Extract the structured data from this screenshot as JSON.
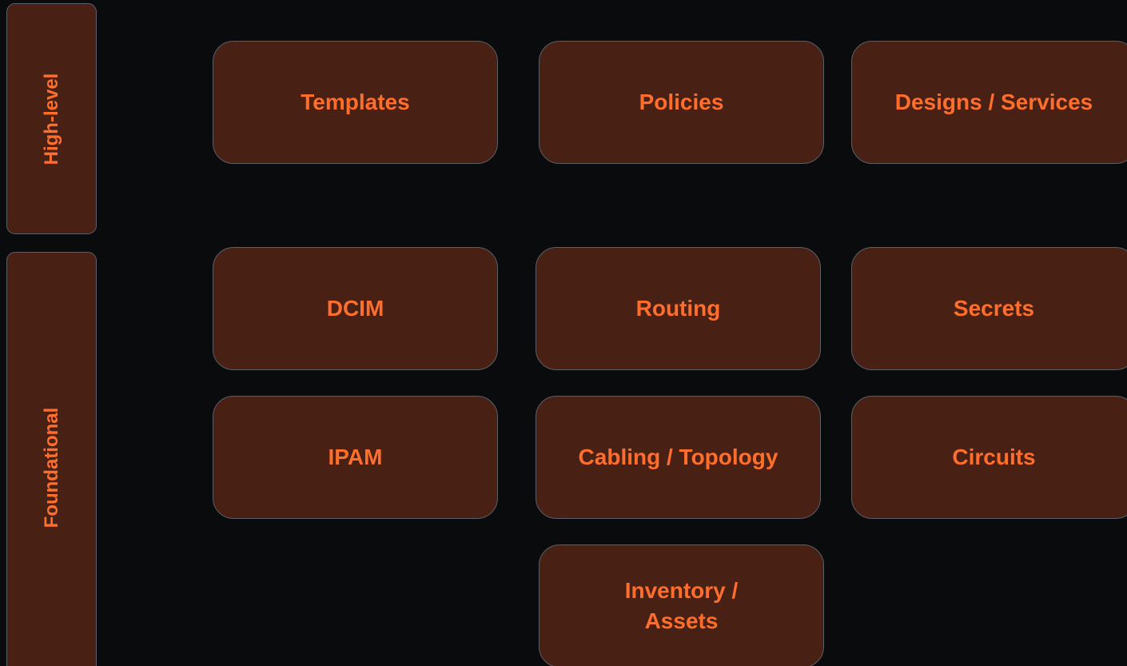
{
  "tiers": {
    "high_level": "High-level",
    "foundational": "Foundational"
  },
  "high_level": {
    "templates": "Templates",
    "policies": "Policies",
    "designs_services": "Designs / Services"
  },
  "foundational": {
    "dcim": "DCIM",
    "routing": "Routing",
    "secrets": "Secrets",
    "ipam": "IPAM",
    "cabling_topology": "Cabling / Topology",
    "circuits": "Circuits",
    "inventory_assets_line1": "Inventory /",
    "inventory_assets_line2": "Assets"
  },
  "colors": {
    "background": "#0a0b0d",
    "box_fill": "#482014",
    "box_border": "#5a5f6a",
    "text_accent": "#ff6e2c"
  }
}
